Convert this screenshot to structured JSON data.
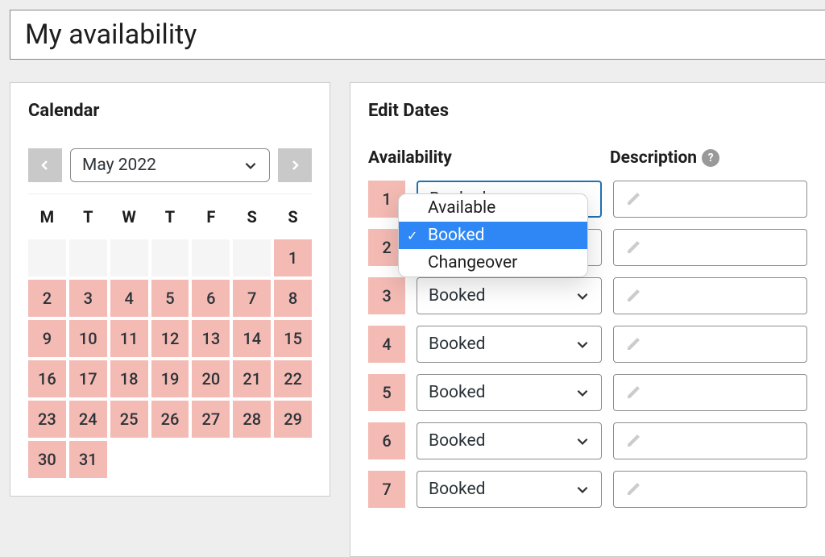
{
  "title": "My availability",
  "calendar": {
    "panel_title": "Calendar",
    "month_label": "May 2022",
    "dow": [
      "M",
      "T",
      "W",
      "T",
      "F",
      "S",
      "S"
    ],
    "cells": [
      {
        "label": "",
        "state": "empty"
      },
      {
        "label": "",
        "state": "empty"
      },
      {
        "label": "",
        "state": "empty"
      },
      {
        "label": "",
        "state": "empty"
      },
      {
        "label": "",
        "state": "empty"
      },
      {
        "label": "",
        "state": "empty"
      },
      {
        "label": "1",
        "state": "sel"
      },
      {
        "label": "2",
        "state": "sel"
      },
      {
        "label": "3",
        "state": "sel"
      },
      {
        "label": "4",
        "state": "sel"
      },
      {
        "label": "5",
        "state": "sel"
      },
      {
        "label": "6",
        "state": "sel"
      },
      {
        "label": "7",
        "state": "sel"
      },
      {
        "label": "8",
        "state": "sel"
      },
      {
        "label": "9",
        "state": "sel"
      },
      {
        "label": "10",
        "state": "sel"
      },
      {
        "label": "11",
        "state": "sel"
      },
      {
        "label": "12",
        "state": "sel"
      },
      {
        "label": "13",
        "state": "sel"
      },
      {
        "label": "14",
        "state": "sel"
      },
      {
        "label": "15",
        "state": "sel"
      },
      {
        "label": "16",
        "state": "sel"
      },
      {
        "label": "17",
        "state": "sel"
      },
      {
        "label": "18",
        "state": "sel"
      },
      {
        "label": "19",
        "state": "sel"
      },
      {
        "label": "20",
        "state": "sel"
      },
      {
        "label": "21",
        "state": "sel"
      },
      {
        "label": "22",
        "state": "sel"
      },
      {
        "label": "23",
        "state": "sel"
      },
      {
        "label": "24",
        "state": "sel"
      },
      {
        "label": "25",
        "state": "sel"
      },
      {
        "label": "26",
        "state": "sel"
      },
      {
        "label": "27",
        "state": "sel"
      },
      {
        "label": "28",
        "state": "sel"
      },
      {
        "label": "29",
        "state": "sel"
      },
      {
        "label": "30",
        "state": "sel"
      },
      {
        "label": "31",
        "state": "sel"
      }
    ]
  },
  "edit": {
    "panel_title": "Edit Dates",
    "col_availability": "Availability",
    "col_description": "Description",
    "help": "?",
    "rows": [
      {
        "day": "1",
        "value": "Booked",
        "focused": true
      },
      {
        "day": "2",
        "value": "Booked",
        "focused": false
      },
      {
        "day": "3",
        "value": "Booked",
        "focused": false
      },
      {
        "day": "4",
        "value": "Booked",
        "focused": false
      },
      {
        "day": "5",
        "value": "Booked",
        "focused": false
      },
      {
        "day": "6",
        "value": "Booked",
        "focused": false
      },
      {
        "day": "7",
        "value": "Booked",
        "focused": false
      }
    ],
    "dropdown": {
      "options": [
        {
          "label": "Available",
          "selected": false
        },
        {
          "label": "Booked",
          "selected": true
        },
        {
          "label": "Changeover",
          "selected": false
        }
      ]
    }
  }
}
